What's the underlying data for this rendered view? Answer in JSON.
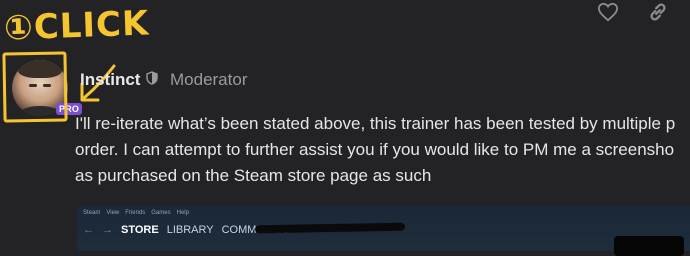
{
  "annotation": {
    "label": "①CLICK",
    "color": "#f5c531"
  },
  "toolbar": {
    "like_icon": "heart-icon",
    "link_icon": "link-icon"
  },
  "post": {
    "username": "Instinct",
    "role": "Moderator",
    "avatar_badge": "PRO",
    "body_lines": [
      "I'll re-iterate what’s been stated above, this trainer has been tested by multiple p",
      "order. I can attempt to further assist you if you would like to PM me a screensho",
      "as purchased on the Steam store page as such"
    ]
  },
  "steam": {
    "menu": [
      "Steam",
      "View",
      "Friends",
      "Games",
      "Help"
    ],
    "nav_back": "←",
    "nav_forward": "→",
    "nav_items": [
      "STORE",
      "LIBRARY",
      "COMMUNITY"
    ]
  },
  "colors": {
    "background": "#232326",
    "badge": "#7a4fd1",
    "steam_bg": "#1b2838"
  }
}
